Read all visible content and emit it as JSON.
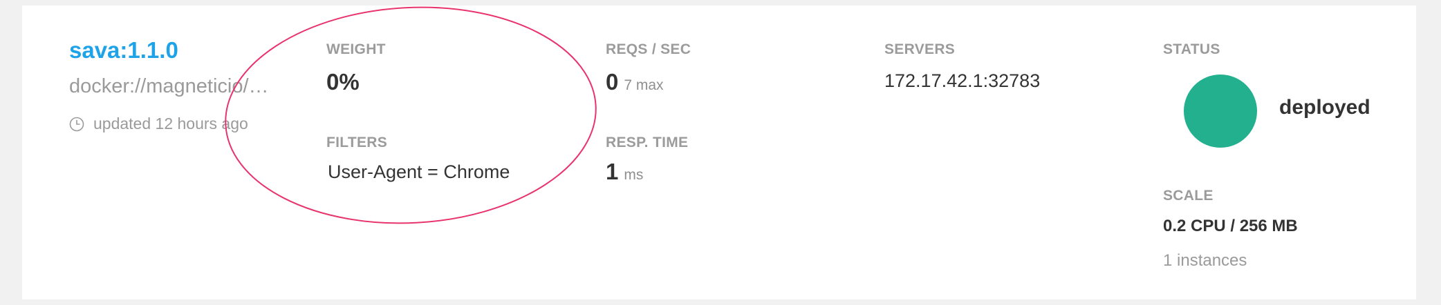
{
  "service": {
    "name": "sava:1.1.0",
    "image": "docker://magneticio/…",
    "updated": "updated 12 hours ago"
  },
  "weight": {
    "label": "WEIGHT",
    "value": "0%"
  },
  "filters": {
    "label": "FILTERS",
    "value": "User-Agent = Chrome"
  },
  "reqs": {
    "label": "REQS / SEC",
    "value": "0",
    "max": "7 max"
  },
  "resp": {
    "label": "RESP. TIME",
    "value": "1",
    "unit": "ms"
  },
  "servers": {
    "label": "SERVERS",
    "value": "172.17.42.1:32783"
  },
  "status": {
    "label": "STATUS",
    "value": "deployed",
    "color": "#23b08f"
  },
  "scale": {
    "label": "SCALE",
    "value": "0.2 CPU / 256 MB",
    "instances": "1 instances"
  },
  "colors": {
    "accent": "#1fa3e8",
    "annotation": "#e8336d"
  },
  "icons": {
    "updated": "clock-icon"
  }
}
